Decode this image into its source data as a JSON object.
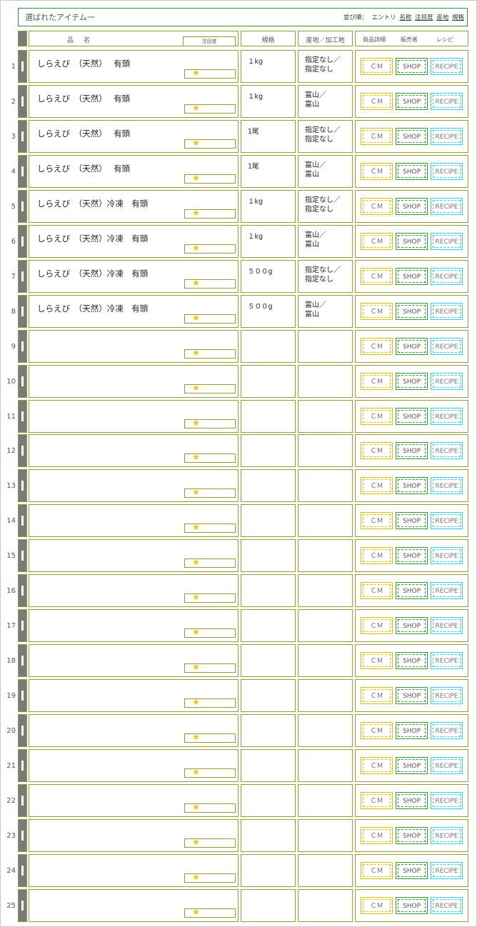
{
  "header": {
    "title": "選ばれたアイテム一",
    "sort_label": "並び順：",
    "sort_options": [
      {
        "label": "エントリ",
        "link": false
      },
      {
        "label": "名称",
        "link": true
      },
      {
        "label": "注目度",
        "link": true
      },
      {
        "label": "産地",
        "link": true
      },
      {
        "label": "規格",
        "link": true
      }
    ]
  },
  "columns": {
    "name": "品名",
    "attention": "注目度",
    "spec": "規格",
    "origin": "産地／加工地",
    "detail": "商品詳細",
    "seller": "販売者",
    "recipe": "レシピ"
  },
  "buttons": {
    "cm": "ＣＭ",
    "shop": "SHOP",
    "recipe": "RECIPE"
  },
  "rating_icon": "star-icon",
  "rows": [
    {
      "num": "1",
      "name": "しらえび　（天然）　 有頭",
      "spec": "１kg",
      "origin": "指定なし／\n指定なし"
    },
    {
      "num": "2",
      "name": "しらえび　（天然）　 有頭",
      "spec": "１kg",
      "origin": "富山／\n富山"
    },
    {
      "num": "3",
      "name": "しらえび　（天然）　 有頭",
      "spec": "1尾",
      "origin": "指定なし／\n指定なし"
    },
    {
      "num": "4",
      "name": "しらえび　（天然）　 有頭",
      "spec": "1尾",
      "origin": "富山／\n富山"
    },
    {
      "num": "5",
      "name": "しらえび　（天然）冷凍　有頭",
      "spec": "１kg",
      "origin": "指定なし／\n指定なし"
    },
    {
      "num": "6",
      "name": "しらえび　（天然）冷凍　有頭",
      "spec": "１kg",
      "origin": "富山／\n富山"
    },
    {
      "num": "7",
      "name": "しらえび　（天然）冷凍　有頭",
      "spec": "５００g",
      "origin": "指定なし／\n指定なし"
    },
    {
      "num": "8",
      "name": "しらえび　（天然）冷凍　有頭",
      "spec": "５００g",
      "origin": "富山／\n富山"
    },
    {
      "num": "9",
      "name": "",
      "spec": "",
      "origin": ""
    },
    {
      "num": "10",
      "name": "",
      "spec": "",
      "origin": ""
    },
    {
      "num": "11",
      "name": "",
      "spec": "",
      "origin": ""
    },
    {
      "num": "12",
      "name": "",
      "spec": "",
      "origin": ""
    },
    {
      "num": "13",
      "name": "",
      "spec": "",
      "origin": ""
    },
    {
      "num": "14",
      "name": "",
      "spec": "",
      "origin": ""
    },
    {
      "num": "15",
      "name": "",
      "spec": "",
      "origin": ""
    },
    {
      "num": "16",
      "name": "",
      "spec": "",
      "origin": ""
    },
    {
      "num": "17",
      "name": "",
      "spec": "",
      "origin": ""
    },
    {
      "num": "18",
      "name": "",
      "spec": "",
      "origin": ""
    },
    {
      "num": "19",
      "name": "",
      "spec": "",
      "origin": ""
    },
    {
      "num": "20",
      "name": "",
      "spec": "",
      "origin": ""
    },
    {
      "num": "21",
      "name": "",
      "spec": "",
      "origin": ""
    },
    {
      "num": "22",
      "name": "",
      "spec": "",
      "origin": ""
    },
    {
      "num": "23",
      "name": "",
      "spec": "",
      "origin": ""
    },
    {
      "num": "24",
      "name": "",
      "spec": "",
      "origin": ""
    },
    {
      "num": "25",
      "name": "",
      "spec": "",
      "origin": ""
    }
  ]
}
